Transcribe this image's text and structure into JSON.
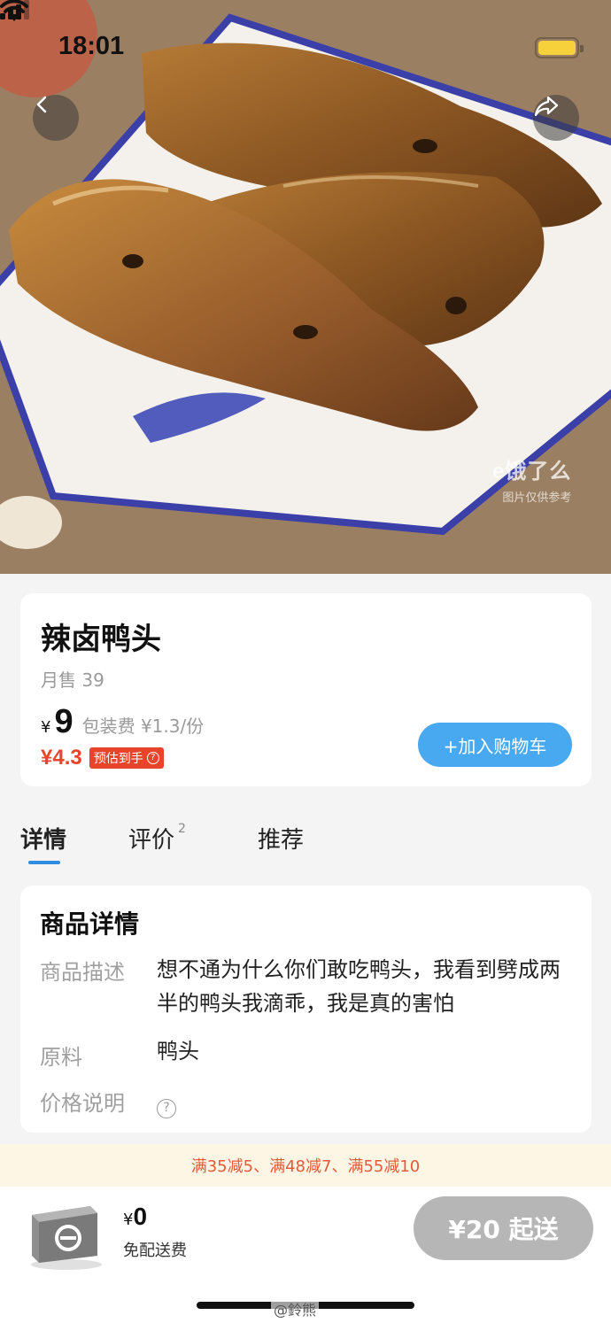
{
  "status_bar": {
    "time": "18:01"
  },
  "watermark": {
    "brand": "e饿了么",
    "note": "图片仅供参考"
  },
  "product": {
    "name": "辣卤鸭头",
    "monthly_sales": "月售 39",
    "currency": "¥",
    "price": "9",
    "packaging_fee": "包装费 ¥1.3/份",
    "estimated_price": "¥4.3",
    "estimated_label": "预估到手",
    "add_to_cart": "+加入购物车"
  },
  "tabs": [
    {
      "label": "详情",
      "active": true
    },
    {
      "label": "评价",
      "count": "2"
    },
    {
      "label": "推荐"
    }
  ],
  "details": {
    "title": "商品详情",
    "rows": [
      {
        "label": "商品描述",
        "value": "想不通为什么你们敢吃鸭头，我看到劈成两半的鸭头我滴乖，我是真的害怕"
      },
      {
        "label": "原料",
        "value": "鸭头"
      },
      {
        "label": "价格说明",
        "value": "?"
      }
    ]
  },
  "promo": "满35减5、满48减7、满55减10",
  "cart": {
    "currency": "¥",
    "amount": "0",
    "delivery_note": "免配送费",
    "min_order_button": "¥20 起送"
  },
  "footer_watermark": "@鈴熊",
  "colors": {
    "accent_blue": "#48a8f0",
    "price_red": "#e8442c",
    "promo_bg": "#fdf6e4"
  }
}
